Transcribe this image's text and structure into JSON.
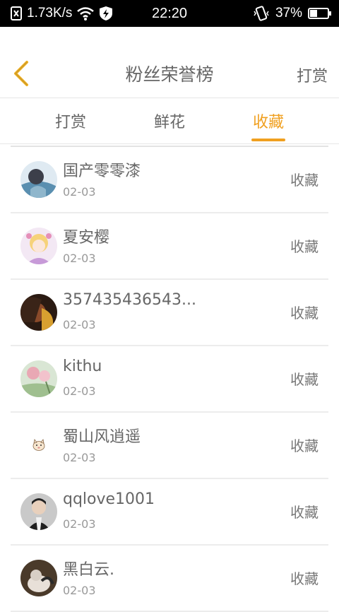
{
  "status_bar": {
    "net_speed": "1.73K/s",
    "time": "22:20",
    "battery": "37%",
    "icons": [
      "no-sim-icon",
      "wifi-icon",
      "shield-bolt-icon",
      "vibrate-icon",
      "battery-icon"
    ]
  },
  "header": {
    "title": "粉丝荣誉榜",
    "action_label": "打赏",
    "back_icon": "chevron-left-icon",
    "accent_color": "#f0a020"
  },
  "tabs": [
    {
      "label": "打赏",
      "active": false
    },
    {
      "label": "鲜花",
      "active": false
    },
    {
      "label": "收藏",
      "active": true
    }
  ],
  "list": {
    "items": [
      {
        "name": "国产零零漆",
        "date": "02-03",
        "action": "收藏"
      },
      {
        "name": "夏安樱",
        "date": "02-03",
        "action": "收藏"
      },
      {
        "name": "357435436543...",
        "date": "02-03",
        "action": "收藏"
      },
      {
        "name": "kithu",
        "date": "02-03",
        "action": "收藏"
      },
      {
        "name": "蜀山风逍遥",
        "date": "02-03",
        "action": "收藏"
      },
      {
        "name": "qqlove1001",
        "date": "02-03",
        "action": "收藏"
      },
      {
        "name": "黑白云.",
        "date": "02-03",
        "action": "收藏"
      }
    ]
  }
}
